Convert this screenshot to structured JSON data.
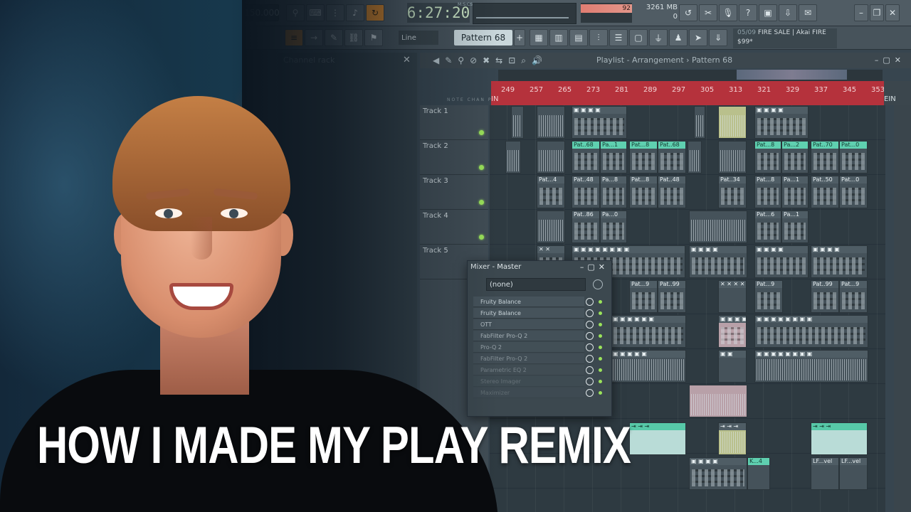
{
  "headline": "HOW I MADE MY PLAY REMIX",
  "toolbar": {
    "tempo": "150.000",
    "song_time": "6:27:20",
    "time_format_label": "M:S:CS",
    "cpu_value": "92",
    "memory": "3261 MB",
    "polyphony": "0",
    "snap_mode": "Line",
    "pattern_selector": "Pattern 68",
    "news_date": "05/09",
    "news_text": "FIRE SALE | Akai FIRE",
    "news_price": "$99*"
  },
  "channel_rack": {
    "title": "Channel rack"
  },
  "playlist": {
    "title": "Playlist - Arrangement › Pattern 68",
    "ruler_ticks": [
      "249",
      "257",
      "265",
      "273",
      "281",
      "289",
      "297",
      "305",
      "313",
      "321",
      "329",
      "337",
      "345",
      "353"
    ],
    "in_marker": "IN",
    "out_marker": "EIN",
    "overview_tabs": [
      "NOTE",
      "CHAN",
      "PAT"
    ],
    "tracks": [
      "Track 1",
      "Track 2",
      "Track 3",
      "Track 4",
      "Track 5"
    ]
  },
  "clips": {
    "c2a": "Pat..68",
    "c2b": "Pa...1",
    "c2c": "Pat...8",
    "c2d": "Pat..68",
    "c2e": "Pat...8",
    "c2f": "Pa...2",
    "c2g": "Pat..70",
    "c2h": "Pat...0",
    "c3a": "Pat...4",
    "c3b": "Pat..48",
    "c3c": "Pa...8",
    "c3d": "Pat...8",
    "c3e": "Pat..48",
    "c3f": "Pat..34",
    "c3g": "Pat...8",
    "c3h": "Pa...1",
    "c3i": "Pat..50",
    "c3j": "Pat...0",
    "c4a": "Pat..86",
    "c4b": "Pa...0",
    "c4c": "Pat...6",
    "c4d": "Pa...1",
    "c6a": "Pat...9",
    "c6b": "Pat..99",
    "c6c": "Pat...9",
    "c6d": "Pat..99",
    "c6e": "Pat...9",
    "c12a": "K...4",
    "c12b": "LF...vel",
    "c12c": "LF...vel"
  },
  "mixer": {
    "title": "Mixer - Master",
    "preset": "(none)",
    "slots": [
      "Fruity Balance",
      "Fruity Balance",
      "OTT",
      "FabFilter Pro-Q 2",
      "Pro-Q 2",
      "FabFilter Pro-Q 2",
      "Parametric EQ 2",
      "Stereo Imager",
      "Maximizer"
    ]
  }
}
